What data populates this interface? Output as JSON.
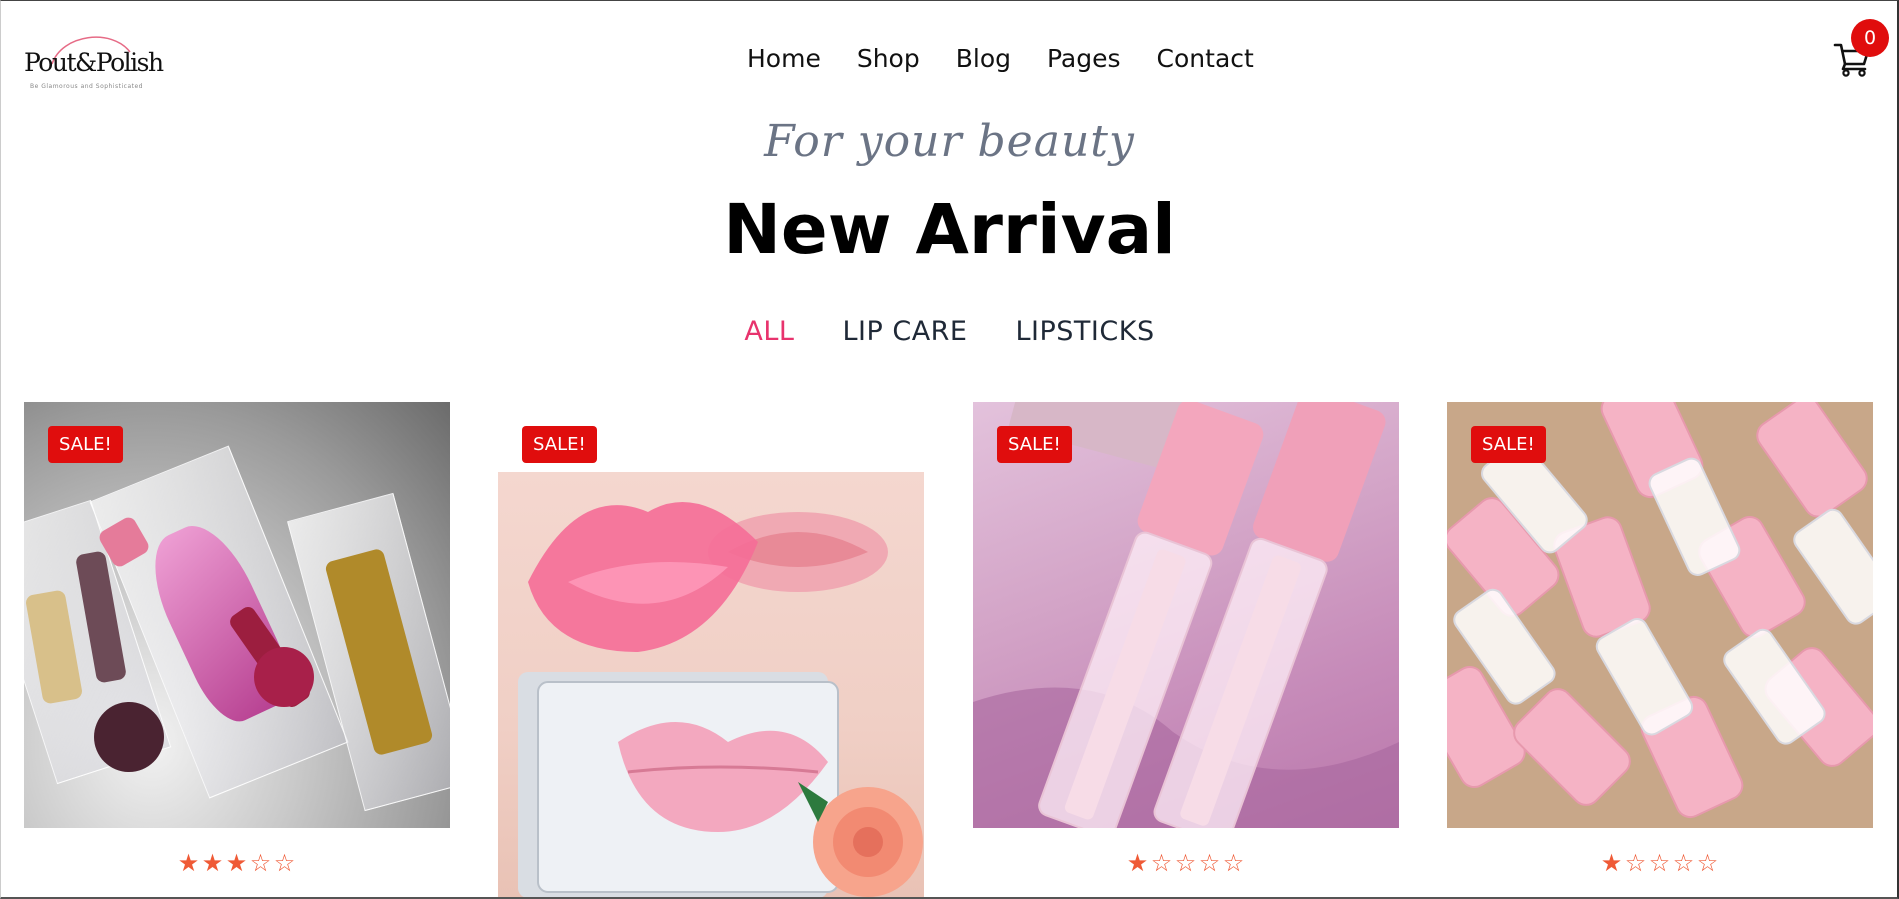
{
  "brand": {
    "name": "Pout&Polish",
    "tagline": "Be Glamorous and Sophisticated"
  },
  "nav": {
    "items": [
      "Home",
      "Shop",
      "Blog",
      "Pages",
      "Contact"
    ]
  },
  "cart": {
    "count": "0",
    "icon": "cart-icon"
  },
  "hero": {
    "kicker": "For your beauty",
    "title": "New Arrival"
  },
  "filters": {
    "items": [
      "ALL",
      "LIP CARE",
      "LIPSTICKS"
    ],
    "active": "ALL"
  },
  "colors": {
    "accent": "#e8336d",
    "sale_badge": "#e00d0d",
    "stars": "#ef5a36"
  },
  "products": [
    {
      "badge": "SALE!",
      "rating": 3,
      "max_rating": 5
    },
    {
      "badge": "SALE!",
      "rating": null,
      "max_rating": 5
    },
    {
      "badge": "SALE!",
      "rating": 1,
      "max_rating": 5
    },
    {
      "badge": "SALE!",
      "rating": 1,
      "max_rating": 5
    }
  ]
}
